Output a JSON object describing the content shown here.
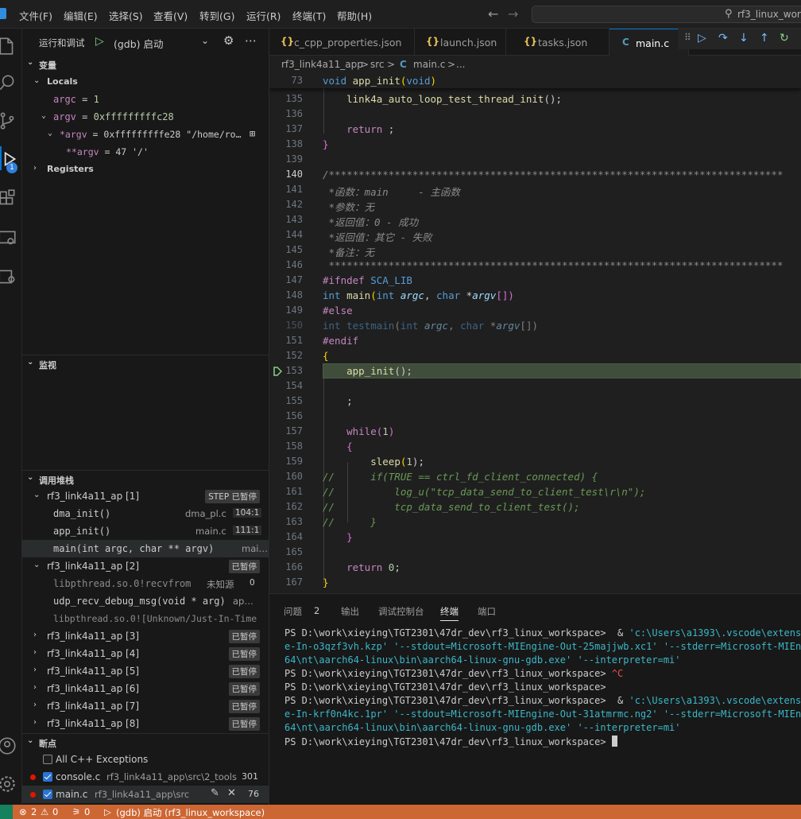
{
  "titlebar": {
    "menu": [
      "文件(F)",
      "编辑(E)",
      "选择(S)",
      "查看(V)",
      "转到(G)",
      "运行(R)",
      "终端(T)",
      "帮助(H)"
    ],
    "search_text": "rf3_linux_workspace"
  },
  "activitybar": {
    "debug_badge": "1"
  },
  "sidebar": {
    "title": "运行和调试",
    "launch_config": "(gdb) 启动",
    "variables": {
      "header": "变量",
      "locals_label": "Locals",
      "argc_name": "argc",
      "argc_eq": " = ",
      "argc_val": "1",
      "argv_name": "argv",
      "argv_eq": " = ",
      "argv_val": "0xfffffffffc28",
      "deref_argv_name": "*argv",
      "deref_argv_eq": " = ",
      "deref_argv_val": "0xfffffffffe28",
      "deref_argv_str": "\"/home/ro…",
      "dderef_argv_name": "**argv",
      "dderef_argv_eq": " = ",
      "dderef_argv_val": "47",
      "dderef_argv_char": "'/'",
      "registers_label": "Registers"
    },
    "watch": {
      "header": "监视"
    },
    "callstack": {
      "header": "调用堆栈",
      "threads": [
        {
          "name": "rf3_link4a11_ap [1]",
          "status": "STEP 已暂停"
        },
        {
          "name": "rf3_link4a11_ap [2]",
          "status": "已暂停"
        },
        {
          "name": "rf3_link4a11_ap [3]",
          "status": "已暂停"
        },
        {
          "name": "rf3_link4a11_ap [4]",
          "status": "已暂停"
        },
        {
          "name": "rf3_link4a11_ap [5]",
          "status": "已暂停"
        },
        {
          "name": "rf3_link4a11_ap [6]",
          "status": "已暂停"
        },
        {
          "name": "rf3_link4a11_ap [7]",
          "status": "已暂停"
        },
        {
          "name": "rf3_link4a11_ap [8]",
          "status": "已暂停"
        }
      ],
      "frames_t1": [
        {
          "fn": "dma_init()",
          "file": "dma_pl.c",
          "pos": "104:1"
        },
        {
          "fn": "app_init()",
          "file": "main.c",
          "pos": "111:1"
        },
        {
          "fn": "main(int argc, char ** argv)",
          "file": "mai…",
          "pos": ""
        }
      ],
      "frames_t2": [
        {
          "fn": "libpthread.so.0!recvfrom",
          "file": "未知源",
          "pos": "0"
        },
        {
          "fn": "udp_recv_debug_msg(void * arg)",
          "file": "ap…",
          "pos": ""
        },
        {
          "fn": "libpthread.so.0![Unknown/Just-In-Time",
          "file": "",
          "pos": ""
        }
      ]
    },
    "breakpoints": {
      "header": "断点",
      "items": [
        {
          "label": "All C++ Exceptions",
          "path": "",
          "line": ""
        },
        {
          "label": "console.c",
          "path": "rf3_link4a11_app\\src\\2_tools",
          "line": "301"
        },
        {
          "label": "main.c",
          "path": "rf3_link4a11_app\\src",
          "line": "76"
        }
      ]
    }
  },
  "tabs": [
    {
      "icon": "{}",
      "label": "c_cpp_properties.json"
    },
    {
      "icon": "{}",
      "label": "launch.json"
    },
    {
      "icon": "{}",
      "label": "tasks.json"
    },
    {
      "icon": "C",
      "label": "main.c"
    }
  ],
  "breadcrumb": {
    "folder": "rf3_link4a11_app",
    "sep1": ">",
    "src": "src",
    "sep2": ">",
    "file_icon": "C",
    "file": "main.c",
    "sep3": ">",
    "more": "..."
  },
  "editor": {
    "sticky_line_no": "73",
    "lines": [
      {
        "no": "135"
      },
      {
        "no": "136"
      },
      {
        "no": "137"
      },
      {
        "no": "138"
      },
      {
        "no": "139"
      },
      {
        "no": "140"
      },
      {
        "no": "141"
      },
      {
        "no": "142"
      },
      {
        "no": "143"
      },
      {
        "no": "144"
      },
      {
        "no": "145"
      },
      {
        "no": "146"
      },
      {
        "no": "147"
      },
      {
        "no": "148"
      },
      {
        "no": "149"
      },
      {
        "no": "150"
      },
      {
        "no": "151"
      },
      {
        "no": "152"
      },
      {
        "no": "153"
      },
      {
        "no": "154"
      },
      {
        "no": "155"
      },
      {
        "no": "156"
      },
      {
        "no": "157"
      },
      {
        "no": "158"
      },
      {
        "no": "159"
      },
      {
        "no": "160"
      },
      {
        "no": "161"
      },
      {
        "no": "162"
      },
      {
        "no": "163"
      },
      {
        "no": "164"
      },
      {
        "no": "165"
      },
      {
        "no": "166"
      },
      {
        "no": "167"
      }
    ],
    "code": {
      "sticky_kw": "void",
      "sticky_fn": "app_init",
      "sticky_paren": "(",
      "sticky_void": "void",
      "sticky_close": ")",
      "l135_fn": "link4a_auto_loop_test_thread_init",
      "l135_rest": "();",
      "l137_kw": "return",
      "l137_rest": " ;",
      "l138": "}",
      "l140": "/****************************************************************************",
      "l141": " *函数：main     - 主函数",
      "l142": " *参数：无",
      "l143": " *返回值：0 - 成功",
      "l144": " *返回值：其它 - 失败",
      "l145": " *备注：无",
      "l146": " ****************************************************************************",
      "l147_pp": "#ifndef",
      "l147_mac": "SCA_LIB",
      "l148_kw": "int",
      "l148_fn": "main",
      "l148_a": "(",
      "l148_int": "int",
      "l148_argc": "argc",
      "l148_comma": ", ",
      "l148_char": "char",
      "l148_star": " *",
      "l148_argv": "argv",
      "l148_end": "[])",
      "l149_pp": "#else",
      "l150_kw": "int",
      "l150_fn": "testmain",
      "l150_a": "(",
      "l150_int": "int",
      "l150_argc": "argc",
      "l150_comma": ", ",
      "l150_char": "char",
      "l150_star": " *",
      "l150_argv": "argv",
      "l150_end": "[])",
      "l151_pp": "#endif",
      "l152": "{",
      "l153_fn": "app_init",
      "l153_rest": "();",
      "l155": ";",
      "l157_kw": "while",
      "l157_a": "(",
      "l157_num": "1",
      "l157_b": ")",
      "l158": "{",
      "l159_fn": "sleep",
      "l159_a": "(",
      "l159_num": "1",
      "l159_b": ");",
      "l160": "//      if(TRUE == ctrl_fd_client_connected) {",
      "l161": "//          log_u(\"tcp_data_send_to_client_test\\r\\n\");",
      "l162": "//          tcp_data_send_to_client_test();",
      "l163": "//      }",
      "l164": "}",
      "l166_kw": "return",
      "l166_num": "0",
      "l166_end": ";",
      "l167": "}"
    }
  },
  "panel": {
    "tabs": [
      "问题",
      "输出",
      "调试控制台",
      "终端",
      "端口"
    ],
    "problems_count": "2",
    "terminal": [
      [
        "PS D:\\work\\xieying\\TGT2301\\47dr_dev\\rf3_linux_workspace>  & ",
        "'c:\\Users\\a1393\\.vscode\\extension"
      ],
      [
        "",
        "e-In-o3qzf3vh.kzp' '--stdout=Microsoft-MIEngine-Out-25majjwb.xc1' '--stderr=Microsoft-MIEngin"
      ],
      [
        "",
        "64\\nt\\aarch64-linux\\bin\\aarch64-linux-gnu-gdb.exe' '--interpreter=mi'"
      ],
      [
        "PS D:\\work\\xieying\\TGT2301\\47dr_dev\\rf3_linux_workspace> ",
        "^C"
      ],
      [
        "PS D:\\work\\xieying\\TGT2301\\47dr_dev\\rf3_linux_workspace>",
        ""
      ],
      [
        "PS D:\\work\\xieying\\TGT2301\\47dr_dev\\rf3_linux_workspace>  & ",
        "'c:\\Users\\a1393\\.vscode\\extension"
      ],
      [
        "",
        "e-In-krf0n4kc.1pr' '--stdout=Microsoft-MIEngine-Out-31atmrmc.ng2' '--stderr=Microsoft-MIEngin"
      ],
      [
        "",
        "64\\nt\\aarch64-linux\\bin\\aarch64-linux-gnu-gdb.exe' '--interpreter=mi'"
      ],
      [
        "PS D:\\work\\xieying\\TGT2301\\47dr_dev\\rf3_linux_workspace> ",
        ""
      ]
    ]
  },
  "statusbar": {
    "errors": "2",
    "warnings": "0",
    "ports": "0",
    "debug": "(gdb) 启动 (rf3_linux_workspace)"
  }
}
